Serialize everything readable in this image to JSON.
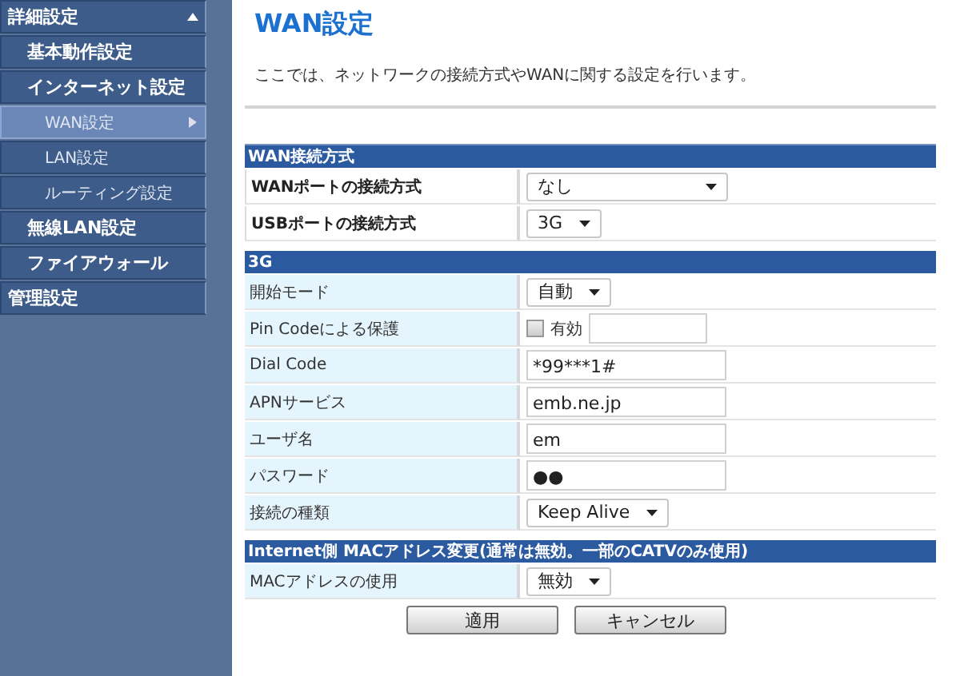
{
  "sidebar": {
    "items": [
      {
        "label": "詳細設定",
        "selected": false,
        "expanded": true,
        "children": [
          {
            "label": "基本動作設定",
            "selected": false
          },
          {
            "label": "インターネット設定",
            "selected": false,
            "children": [
              {
                "label": "WAN設定",
                "selected": true
              },
              {
                "label": "LAN設定",
                "selected": false
              },
              {
                "label": "ルーティング設定",
                "selected": false
              }
            ]
          },
          {
            "label": "無線LAN設定",
            "selected": false
          },
          {
            "label": "ファイアウォール",
            "selected": false
          }
        ]
      },
      {
        "label": "管理設定",
        "selected": false
      }
    ]
  },
  "page": {
    "title": "WAN設定",
    "description": "ここでは、ネットワークの接続方式やWANに関する設定を行います。"
  },
  "sections": [
    {
      "title": "WAN接続方式",
      "kind": "primary",
      "rows": [
        {
          "label": "WANポートの接続方式",
          "kind": "select",
          "value": "なし"
        },
        {
          "label": "USBポートの接続方式",
          "kind": "select",
          "value": "3G"
        }
      ]
    },
    {
      "title": "3G",
      "kind": "detail",
      "rows": [
        {
          "label": "開始モード",
          "kind": "select",
          "value": "自動"
        },
        {
          "label": "Pin Codeによる保護",
          "kind": "pin",
          "checkbox_label": "有効",
          "checked": false
        },
        {
          "label": "Dial Code",
          "kind": "text",
          "value": "*99***1#"
        },
        {
          "label": "APNサービス",
          "kind": "text",
          "value": "emb.ne.jp"
        },
        {
          "label": "ユーザ名",
          "kind": "text",
          "value": "em"
        },
        {
          "label": "パスワード",
          "kind": "text",
          "value": "●●"
        },
        {
          "label": "接続の種類",
          "kind": "select",
          "value": "Keep Alive"
        }
      ]
    },
    {
      "title": "Internet側 MACアドレス変更(通常は無効。一部のCATVのみ使用)",
      "kind": "detail",
      "rows": [
        {
          "label": "MACアドレスの使用",
          "kind": "select",
          "value": "無効"
        }
      ]
    }
  ],
  "buttons": [
    "適用",
    "キャンセル"
  ]
}
